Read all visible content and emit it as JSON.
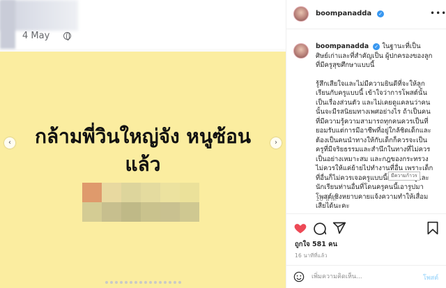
{
  "facebook_post": {
    "date": "4 May",
    "post_text_line1": "กล้ามพี่วินใหญ่จัง หนูซ้อน",
    "post_text_line2": "แล้ว",
    "background_color": "#fbeda0",
    "censor_colors": [
      "#df9a6c",
      "#e8d9a0",
      "#ddd59c",
      "#e4db9f",
      "#ece29f",
      "#ebe19a",
      "#d4cc94",
      "#c7bf8e",
      "#bfb987",
      "#c9c28d",
      "#c9c190",
      "#cfc891"
    ]
  },
  "instagram": {
    "username": "boompanadda",
    "verified": true,
    "caption_lead": "ในฐานะที่เป็น ศิษย์เก่าและที่สำคัญเป็น ผู้ปกครองของลูกที่มีครูสุขศึกษาแบบนี้",
    "caption_body": "รู้สึกเสียใจและไม่มีความยินดีที่จะให้ลูกเรียนกับครูแบบนี้ เข้าใจว่าการโพสต์นั้นเป็นเรื่องส่วนตัว และไม่เคยดูแคลนว่าคนนั้นจะมีรสนิยมทางเพศอย่างไร ถ้าเป็นคนที่มีความรู้ความสามารถทุกคนควรเป็นที่ยอมรับแต่การมีอาชีพที่อยู่ใกล้ชิดเด็กและต้องเป็นคนนำทางให้กับเด็กก็ควรจะเป็นครูที่มีจริยธรรมและสำนึกในทางที่ไม่ควรเป็นอย่างเหมาะสม และกฎของกระทรวงไม่ควรให้แค่ย้ายไปทำงานที่อื่น เพราะเด็กที่อื่นก็ไม่ควรเจอครูแบบนี้เช่นกัน ครูและนักเรียนท่านอื่นที่โดนครูคนนี้เอารูปมาโพสต์เชิงหยาบคายแจ้งความทำให้เสื่อมเสียได้นะคะ",
    "tooltip": "มีความก้าวร",
    "caption_time": "16 นาที",
    "likes": "ถูกใจ 581 คน",
    "post_time": "16 นาทีที่แล้ว",
    "comment_placeholder": "เพิ่มความคิดเห็น...",
    "post_button": "โพสต์",
    "colors": {
      "like_red": "#ed4956",
      "verified_blue": "#3897f0",
      "text": "#262626",
      "muted": "#8e8e8e"
    }
  }
}
